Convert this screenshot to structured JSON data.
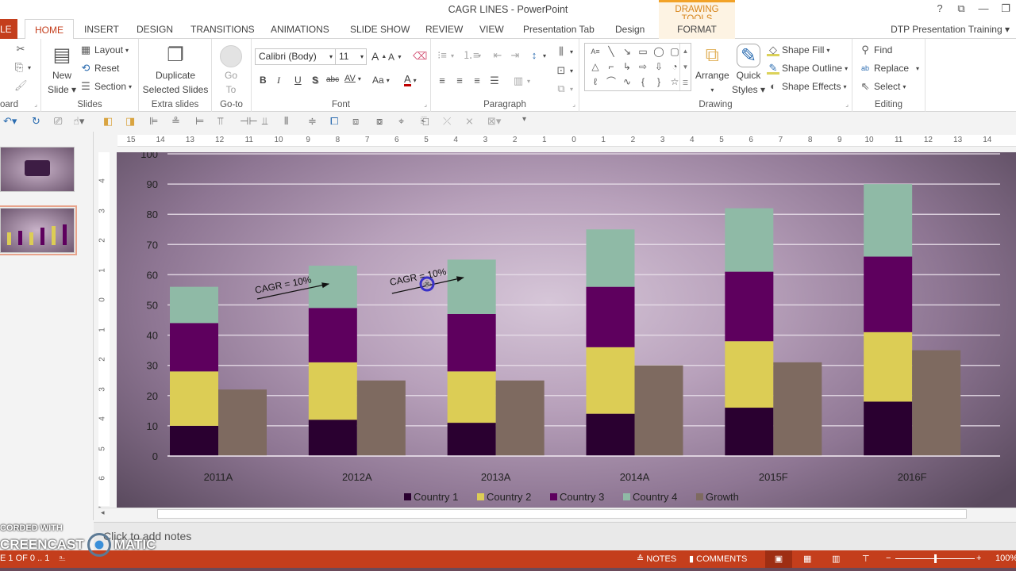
{
  "window": {
    "title": "CAGR LINES - PowerPoint",
    "contextual_header": "DRAWING TOOLS",
    "controls": {
      "help": "?",
      "ribbon_display": "⧉",
      "minimize": "—",
      "restore": "❐"
    }
  },
  "tabs": {
    "file": "LE",
    "items": [
      "HOME",
      "INSERT",
      "DESIGN",
      "TRANSITIONS",
      "ANIMATIONS",
      "SLIDE SHOW",
      "REVIEW",
      "VIEW",
      "Presentation Tab",
      "Design",
      "FORMAT"
    ],
    "active": "HOME",
    "account": "DTP Presentation Training"
  },
  "ribbon": {
    "clipboard": {
      "label": "oard"
    },
    "slides": {
      "label": "Slides",
      "new_slide": "New",
      "new_slide2": "Slide",
      "layout": "Layout",
      "reset": "Reset",
      "section": "Section"
    },
    "extra_slides": {
      "label": "Extra slides",
      "duplicate": "Duplicate",
      "duplicate2": "Selected Slides"
    },
    "goto": {
      "label": "Go-to",
      "go": "Go",
      "to": "To"
    },
    "font": {
      "label": "Font",
      "font_name": "Calibri (Body)",
      "font_size": "11",
      "bold": "B",
      "italic": "I",
      "underline": "U",
      "shadow": "S",
      "strike": "abc",
      "spacing": "AV",
      "case": "Aa",
      "color": "A",
      "grow": "A",
      "shrink": "A"
    },
    "paragraph": {
      "label": "Paragraph"
    },
    "drawing": {
      "label": "Drawing",
      "arrange": "Arrange",
      "quick_styles": "Quick",
      "quick_styles2": "Styles",
      "shape_fill": "Shape Fill",
      "shape_outline": "Shape Outline",
      "shape_effects": "Shape Effects",
      "shapes": [
        "A≡",
        "╲",
        "↘",
        "▭",
        "◯",
        "▢",
        "△",
        "⌐",
        "↳",
        "⇨",
        "⇩",
        "◔",
        "ℓ",
        "⌒",
        "∿",
        "{",
        "}",
        "☆"
      ]
    },
    "editing": {
      "label": "Editing",
      "find": "Find",
      "replace": "Replace",
      "select": "Select"
    }
  },
  "ruler": {
    "horizontal": [
      "15",
      "14",
      "13",
      "12",
      "11",
      "10",
      "9",
      "8",
      "7",
      "6",
      "5",
      "4",
      "3",
      "2",
      "1",
      "0",
      "1",
      "2",
      "3",
      "4",
      "5",
      "6",
      "7",
      "8",
      "9",
      "10",
      "11",
      "12",
      "13",
      "14"
    ],
    "vertical": [
      "4",
      "3",
      "2",
      "1",
      "0",
      "1",
      "2",
      "3",
      "4",
      "5",
      "6",
      "7"
    ]
  },
  "chart_data": {
    "type": "bar",
    "subtype": "stacked-clustered",
    "title": "",
    "xlabel": "",
    "ylabel": "",
    "categories": [
      "2011A",
      "2012A",
      "2013A",
      "2014A",
      "2015F",
      "2016F"
    ],
    "ylim": [
      0,
      100
    ],
    "yticks": [
      0,
      10,
      20,
      30,
      40,
      50,
      60,
      70,
      80,
      90,
      100
    ],
    "grid": true,
    "legend_position": "bottom",
    "series": [
      {
        "name": "Country 1",
        "stack": "countries",
        "color": "#2a0030",
        "values": [
          10,
          12,
          11,
          14,
          16,
          18
        ]
      },
      {
        "name": "Country 2",
        "stack": "countries",
        "color": "#dccd55",
        "values": [
          18,
          19,
          17,
          22,
          22,
          23
        ]
      },
      {
        "name": "Country 3",
        "stack": "countries",
        "color": "#5e005e",
        "values": [
          16,
          18,
          19,
          20,
          23,
          25
        ]
      },
      {
        "name": "Country 4",
        "stack": "countries",
        "color": "#8fbaa6",
        "values": [
          12,
          14,
          18,
          19,
          21,
          24
        ]
      },
      {
        "name": "Growth",
        "stack": "growth",
        "color": "#7e6a60",
        "values": [
          22,
          25,
          25,
          30,
          31,
          35
        ]
      }
    ],
    "annotations": [
      {
        "text": "CAGR = 10%",
        "between": [
          "2011A",
          "2012A"
        ],
        "kind": "arrow"
      },
      {
        "text": "CAGR = 10%",
        "between": [
          "2012A",
          "2013A"
        ],
        "kind": "arrow",
        "selected": true
      }
    ]
  },
  "notes": {
    "placeholder": "Click to add notes"
  },
  "status": {
    "slide_info": "E 1 OF 0 .. 1",
    "notes": "NOTES",
    "comments": "COMMENTS",
    "zoom": "100%",
    "zoom_level": 0.5
  },
  "watermark": {
    "line1": "CORDED WITH",
    "line2": "CREENCAST",
    "line3": "MATIC"
  }
}
